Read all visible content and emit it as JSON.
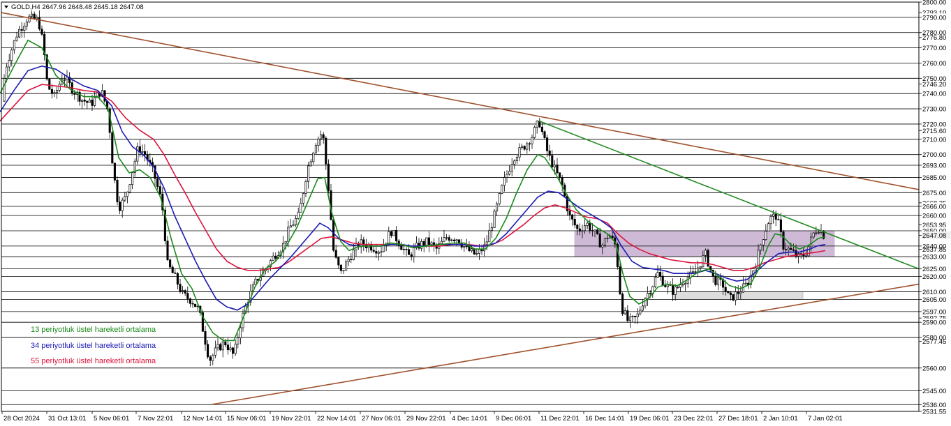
{
  "header": {
    "text": "GOLD,H4  2647.96 2648.48 2645.18 2647.08",
    "menu_icon": "triangle-down-icon"
  },
  "legend": [
    {
      "text": "13 periyotluk üstel hareketli ortalama",
      "color": "#1a8a1a"
    },
    {
      "text": "34 periyotluk üstel hareketli ortalama",
      "color": "#1a1ab4"
    },
    {
      "text": "55 periyotluk üstel hareketli ortalama",
      "color": "#dc143c"
    }
  ],
  "colors": {
    "background": "#ffffff",
    "candles": "#000000",
    "hlines": "#000000",
    "ema13": "#1a8a1a",
    "ema34": "#1a1ab4",
    "ema55": "#dc143c",
    "upper_trendline": "#a0522d",
    "lower_trendline": "#a0522d",
    "green_trendline": "#228b22",
    "zone_purple": "#c9b3d1",
    "zone_gray": "#d9d9d9"
  },
  "chart_data": {
    "type": "candlestick",
    "symbol": "GOLD",
    "timeframe": "H4",
    "ylim": [
      2531.55,
      2800.0
    ],
    "y_labels": [
      "2800.00",
      "2793.10",
      "2790.00",
      "2780.00",
      "2776.80",
      "2770.00",
      "2760.00",
      "2750.00",
      "2746.20",
      "2740.00",
      "2730.00",
      "2720.00",
      "2715.60",
      "2710.00",
      "2700.00",
      "2693.00",
      "2685.00",
      "2675.00",
      "2668.35",
      "2666.00",
      "2660.00",
      "2653.95",
      "2650.00",
      "2647.08",
      "2640.00",
      "2637.85",
      "2633.00",
      "2625.00",
      "2620.00",
      "2610.00",
      "2605.00",
      "2597.00",
      "2592.75",
      "2590.00",
      "2580.00",
      "2577.45",
      "2560.00",
      "2545.00",
      "2536.00",
      "2531.55"
    ],
    "hlines": [
      2790,
      2780,
      2770,
      2760,
      2750,
      2740,
      2730,
      2720,
      2710,
      2700,
      2693,
      2685,
      2675,
      2666,
      2660,
      2650,
      2640,
      2633,
      2625,
      2620,
      2610,
      2605,
      2597,
      2590,
      2580,
      2560,
      2545,
      2536
    ],
    "current_price": 2647.08,
    "x_labels": [
      "28 Oct 2024",
      "31 Oct 13:01",
      "5 Nov 06:01",
      "7 Nov 22:01",
      "12 Nov 14:01",
      "15 Nov 06:01",
      "19 Nov 22:01",
      "22 Nov 14:01",
      "27 Nov 06:01",
      "29 Nov 22:01",
      "4 Dec 14:01",
      "9 Dec 06:01",
      "11 Dec 22:01",
      "16 Dec 14:01",
      "19 Dec 06:01",
      "23 Dec 22:01",
      "27 Dec 18:01",
      "2 Jan 10:01",
      "7 Jan 02:01"
    ],
    "price_path": [
      [
        0,
        2735
      ],
      [
        10,
        2760
      ],
      [
        25,
        2780
      ],
      [
        40,
        2790
      ],
      [
        55,
        2788
      ],
      [
        62,
        2772
      ],
      [
        68,
        2745
      ],
      [
        78,
        2738
      ],
      [
        90,
        2752
      ],
      [
        105,
        2742
      ],
      [
        118,
        2736
      ],
      [
        130,
        2733
      ],
      [
        145,
        2742
      ],
      [
        155,
        2728
      ],
      [
        162,
        2690
      ],
      [
        170,
        2665
      ],
      [
        180,
        2672
      ],
      [
        190,
        2690
      ],
      [
        198,
        2705
      ],
      [
        208,
        2700
      ],
      [
        220,
        2688
      ],
      [
        232,
        2668
      ],
      [
        240,
        2628
      ],
      [
        250,
        2620
      ],
      [
        262,
        2608
      ],
      [
        275,
        2604
      ],
      [
        285,
        2598
      ],
      [
        292,
        2582
      ],
      [
        300,
        2565
      ],
      [
        310,
        2572
      ],
      [
        322,
        2577
      ],
      [
        335,
        2568
      ],
      [
        345,
        2590
      ],
      [
        355,
        2605
      ],
      [
        368,
        2618
      ],
      [
        380,
        2625
      ],
      [
        395,
        2635
      ],
      [
        405,
        2640
      ],
      [
        415,
        2652
      ],
      [
        428,
        2660
      ],
      [
        440,
        2690
      ],
      [
        452,
        2708
      ],
      [
        462,
        2715
      ],
      [
        470,
        2680
      ],
      [
        478,
        2635
      ],
      [
        488,
        2622
      ],
      [
        500,
        2632
      ],
      [
        515,
        2642
      ],
      [
        530,
        2640
      ],
      [
        545,
        2637
      ],
      [
        560,
        2650
      ],
      [
        572,
        2642
      ],
      [
        585,
        2633
      ],
      [
        598,
        2640
      ],
      [
        612,
        2643
      ],
      [
        625,
        2638
      ],
      [
        640,
        2646
      ],
      [
        655,
        2645
      ],
      [
        668,
        2638
      ],
      [
        682,
        2634
      ],
      [
        695,
        2640
      ],
      [
        708,
        2660
      ],
      [
        720,
        2680
      ],
      [
        735,
        2698
      ],
      [
        750,
        2705
      ],
      [
        762,
        2712
      ],
      [
        772,
        2722
      ],
      [
        785,
        2700
      ],
      [
        795,
        2690
      ],
      [
        805,
        2680
      ],
      [
        815,
        2660
      ],
      [
        828,
        2650
      ],
      [
        840,
        2655
      ],
      [
        852,
        2648
      ],
      [
        862,
        2640
      ],
      [
        872,
        2648
      ],
      [
        882,
        2640
      ],
      [
        890,
        2600
      ],
      [
        900,
        2590
      ],
      [
        912,
        2593
      ],
      [
        922,
        2605
      ],
      [
        932,
        2612
      ],
      [
        942,
        2622
      ],
      [
        952,
        2615
      ],
      [
        965,
        2610
      ],
      [
        980,
        2618
      ],
      [
        995,
        2622
      ],
      [
        1010,
        2635
      ],
      [
        1022,
        2618
      ],
      [
        1035,
        2615
      ],
      [
        1045,
        2605
      ],
      [
        1058,
        2610
      ],
      [
        1070,
        2615
      ],
      [
        1082,
        2628
      ],
      [
        1092,
        2645
      ],
      [
        1102,
        2658
      ],
      [
        1112,
        2660
      ],
      [
        1122,
        2640
      ],
      [
        1135,
        2636
      ],
      [
        1145,
        2632
      ],
      [
        1155,
        2636
      ],
      [
        1165,
        2648
      ],
      [
        1172,
        2652
      ],
      [
        1180,
        2647
      ]
    ],
    "ema13": [
      [
        0,
        2740
      ],
      [
        20,
        2758
      ],
      [
        40,
        2775
      ],
      [
        60,
        2770
      ],
      [
        80,
        2752
      ],
      [
        100,
        2743
      ],
      [
        120,
        2738
      ],
      [
        140,
        2738
      ],
      [
        155,
        2730
      ],
      [
        170,
        2698
      ],
      [
        185,
        2688
      ],
      [
        200,
        2690
      ],
      [
        215,
        2685
      ],
      [
        230,
        2672
      ],
      [
        245,
        2645
      ],
      [
        260,
        2622
      ],
      [
        275,
        2612
      ],
      [
        290,
        2594
      ],
      [
        305,
        2583
      ],
      [
        320,
        2578
      ],
      [
        335,
        2578
      ],
      [
        350,
        2595
      ],
      [
        365,
        2613
      ],
      [
        380,
        2625
      ],
      [
        395,
        2630
      ],
      [
        410,
        2640
      ],
      [
        425,
        2652
      ],
      [
        440,
        2668
      ],
      [
        455,
        2684
      ],
      [
        465,
        2685
      ],
      [
        475,
        2662
      ],
      [
        488,
        2643
      ],
      [
        500,
        2637
      ],
      [
        515,
        2640
      ],
      [
        530,
        2640
      ],
      [
        545,
        2640
      ],
      [
        560,
        2642
      ],
      [
        575,
        2641
      ],
      [
        590,
        2639
      ],
      [
        610,
        2640
      ],
      [
        630,
        2641
      ],
      [
        650,
        2642
      ],
      [
        665,
        2642
      ],
      [
        680,
        2638
      ],
      [
        695,
        2638
      ],
      [
        710,
        2645
      ],
      [
        725,
        2658
      ],
      [
        740,
        2675
      ],
      [
        755,
        2690
      ],
      [
        770,
        2700
      ],
      [
        780,
        2698
      ],
      [
        795,
        2688
      ],
      [
        810,
        2675
      ],
      [
        825,
        2664
      ],
      [
        840,
        2657
      ],
      [
        855,
        2652
      ],
      [
        870,
        2648
      ],
      [
        882,
        2642
      ],
      [
        892,
        2622
      ],
      [
        902,
        2607
      ],
      [
        915,
        2602
      ],
      [
        928,
        2605
      ],
      [
        942,
        2613
      ],
      [
        955,
        2615
      ],
      [
        970,
        2614
      ],
      [
        985,
        2618
      ],
      [
        1000,
        2623
      ],
      [
        1015,
        2625
      ],
      [
        1030,
        2620
      ],
      [
        1045,
        2614
      ],
      [
        1060,
        2612
      ],
      [
        1075,
        2615
      ],
      [
        1088,
        2626
      ],
      [
        1100,
        2640
      ],
      [
        1110,
        2648
      ],
      [
        1120,
        2647
      ],
      [
        1132,
        2641
      ],
      [
        1145,
        2638
      ],
      [
        1160,
        2641
      ],
      [
        1172,
        2645
      ],
      [
        1182,
        2646
      ]
    ],
    "ema34": [
      [
        0,
        2728
      ],
      [
        20,
        2742
      ],
      [
        40,
        2755
      ],
      [
        60,
        2758
      ],
      [
        80,
        2756
      ],
      [
        100,
        2750
      ],
      [
        120,
        2745
      ],
      [
        140,
        2742
      ],
      [
        160,
        2732
      ],
      [
        175,
        2715
      ],
      [
        190,
        2705
      ],
      [
        205,
        2700
      ],
      [
        220,
        2692
      ],
      [
        235,
        2678
      ],
      [
        250,
        2660
      ],
      [
        265,
        2645
      ],
      [
        280,
        2630
      ],
      [
        295,
        2617
      ],
      [
        310,
        2605
      ],
      [
        325,
        2600
      ],
      [
        340,
        2598
      ],
      [
        355,
        2602
      ],
      [
        370,
        2610
      ],
      [
        385,
        2618
      ],
      [
        400,
        2625
      ],
      [
        415,
        2632
      ],
      [
        430,
        2640
      ],
      [
        445,
        2648
      ],
      [
        458,
        2655
      ],
      [
        470,
        2652
      ],
      [
        485,
        2645
      ],
      [
        500,
        2641
      ],
      [
        515,
        2640
      ],
      [
        530,
        2640
      ],
      [
        545,
        2640
      ],
      [
        560,
        2641
      ],
      [
        575,
        2641
      ],
      [
        590,
        2640
      ],
      [
        610,
        2640
      ],
      [
        630,
        2641
      ],
      [
        650,
        2641
      ],
      [
        665,
        2641
      ],
      [
        680,
        2640
      ],
      [
        695,
        2640
      ],
      [
        710,
        2642
      ],
      [
        725,
        2648
      ],
      [
        740,
        2656
      ],
      [
        755,
        2664
      ],
      [
        770,
        2672
      ],
      [
        785,
        2676
      ],
      [
        800,
        2675
      ],
      [
        815,
        2670
      ],
      [
        830,
        2665
      ],
      [
        845,
        2661
      ],
      [
        860,
        2657
      ],
      [
        875,
        2652
      ],
      [
        890,
        2640
      ],
      [
        905,
        2630
      ],
      [
        920,
        2626
      ],
      [
        935,
        2625
      ],
      [
        950,
        2624
      ],
      [
        965,
        2622
      ],
      [
        980,
        2622
      ],
      [
        995,
        2622
      ],
      [
        1010,
        2624
      ],
      [
        1025,
        2622
      ],
      [
        1040,
        2619
      ],
      [
        1055,
        2617
      ],
      [
        1070,
        2618
      ],
      [
        1085,
        2624
      ],
      [
        1100,
        2630
      ],
      [
        1115,
        2635
      ],
      [
        1130,
        2636
      ],
      [
        1145,
        2636
      ],
      [
        1160,
        2638
      ],
      [
        1170,
        2640
      ],
      [
        1182,
        2641
      ]
    ],
    "ema55": [
      [
        0,
        2722
      ],
      [
        20,
        2732
      ],
      [
        40,
        2742
      ],
      [
        60,
        2746
      ],
      [
        80,
        2745
      ],
      [
        100,
        2744
      ],
      [
        120,
        2742
      ],
      [
        140,
        2741
      ],
      [
        160,
        2735
      ],
      [
        180,
        2724
      ],
      [
        200,
        2716
      ],
      [
        220,
        2710
      ],
      [
        235,
        2700
      ],
      [
        250,
        2687
      ],
      [
        265,
        2675
      ],
      [
        280,
        2662
      ],
      [
        295,
        2650
      ],
      [
        310,
        2638
      ],
      [
        325,
        2630
      ],
      [
        340,
        2626
      ],
      [
        355,
        2624
      ],
      [
        370,
        2624
      ],
      [
        385,
        2625
      ],
      [
        400,
        2626
      ],
      [
        415,
        2630
      ],
      [
        430,
        2635
      ],
      [
        445,
        2640
      ],
      [
        460,
        2645
      ],
      [
        475,
        2646
      ],
      [
        490,
        2644
      ],
      [
        505,
        2642
      ],
      [
        520,
        2641
      ],
      [
        535,
        2641
      ],
      [
        550,
        2641
      ],
      [
        570,
        2641
      ],
      [
        590,
        2640
      ],
      [
        610,
        2640
      ],
      [
        630,
        2640
      ],
      [
        650,
        2641
      ],
      [
        670,
        2641
      ],
      [
        690,
        2640
      ],
      [
        705,
        2641
      ],
      [
        720,
        2644
      ],
      [
        735,
        2649
      ],
      [
        750,
        2654
      ],
      [
        765,
        2660
      ],
      [
        780,
        2665
      ],
      [
        795,
        2667
      ],
      [
        810,
        2665
      ],
      [
        825,
        2662
      ],
      [
        840,
        2659
      ],
      [
        855,
        2658
      ],
      [
        870,
        2655
      ],
      [
        885,
        2648
      ],
      [
        900,
        2642
      ],
      [
        915,
        2638
      ],
      [
        930,
        2635
      ],
      [
        945,
        2633
      ],
      [
        960,
        2631
      ],
      [
        975,
        2630
      ],
      [
        990,
        2629
      ],
      [
        1005,
        2629
      ],
      [
        1020,
        2628
      ],
      [
        1035,
        2626
      ],
      [
        1050,
        2624
      ],
      [
        1065,
        2624
      ],
      [
        1080,
        2626
      ],
      [
        1095,
        2629
      ],
      [
        1110,
        2631
      ],
      [
        1125,
        2633
      ],
      [
        1140,
        2634
      ],
      [
        1155,
        2635
      ],
      [
        1170,
        2636
      ],
      [
        1182,
        2637
      ]
    ],
    "trendlines": {
      "upper": {
        "from": [
          "28 Oct 2024",
          2793.1
        ],
        "to": [
          "beyond 7 Jan 02:01",
          2677
        ],
        "color": "#a0522d"
      },
      "lower": {
        "from": [
          "13 Nov",
          2536.0
        ],
        "to": [
          "beyond 7 Jan 02:01",
          2615
        ],
        "color": "#a0522d"
      },
      "green": {
        "from": [
          "11 Dec 22:01",
          2722
        ],
        "to": [
          "beyond 7 Jan 02:01",
          2625
        ],
        "color": "#228b22"
      }
    },
    "zones": [
      {
        "name": "resistance-zone",
        "y_from": 2633,
        "y_to": 2650,
        "color": "#c9b3d1"
      },
      {
        "name": "support-zone",
        "y_from": 2605,
        "y_to": 2610,
        "color": "#d9d9d9"
      }
    ]
  }
}
